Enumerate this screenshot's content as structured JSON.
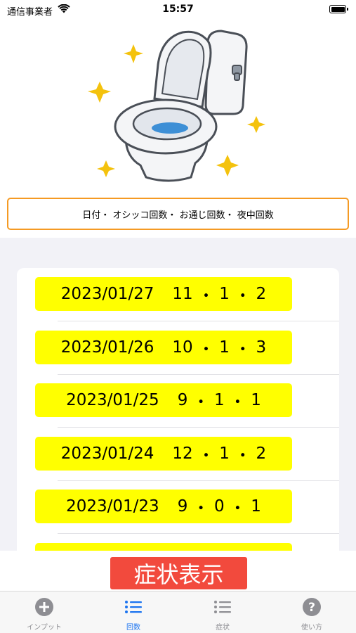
{
  "status_bar": {
    "carrier": "通信事業者",
    "time": "15:57"
  },
  "header": {
    "columns_label": "日付・ オシッコ回数・ お通じ回数・ 夜中回数"
  },
  "records": [
    {
      "date": "2023/01/27",
      "urination": "11",
      "bowel": "1",
      "night": "2"
    },
    {
      "date": "2023/01/26",
      "urination": "10",
      "bowel": "1",
      "night": "3"
    },
    {
      "date": "2023/01/25",
      "urination": "9",
      "bowel": "1",
      "night": "1"
    },
    {
      "date": "2023/01/24",
      "urination": "12",
      "bowel": "1",
      "night": "2"
    },
    {
      "date": "2023/01/23",
      "urination": "9",
      "bowel": "0",
      "night": "1"
    }
  ],
  "symptom_button": {
    "label": "症状表示"
  },
  "tabs": [
    {
      "label": "インプット",
      "icon": "plus-circle-icon",
      "active": false
    },
    {
      "label": "回数",
      "icon": "list-icon",
      "active": true
    },
    {
      "label": "症状",
      "icon": "list-icon",
      "active": false
    },
    {
      "label": "使い方",
      "icon": "question-circle-icon",
      "active": false
    }
  ],
  "colors": {
    "accent": "#1a73f0",
    "row_highlight": "#ffff00",
    "header_border": "#f59a23",
    "symptom_button": "#f24a3d",
    "tab_inactive": "#8e8e93"
  }
}
